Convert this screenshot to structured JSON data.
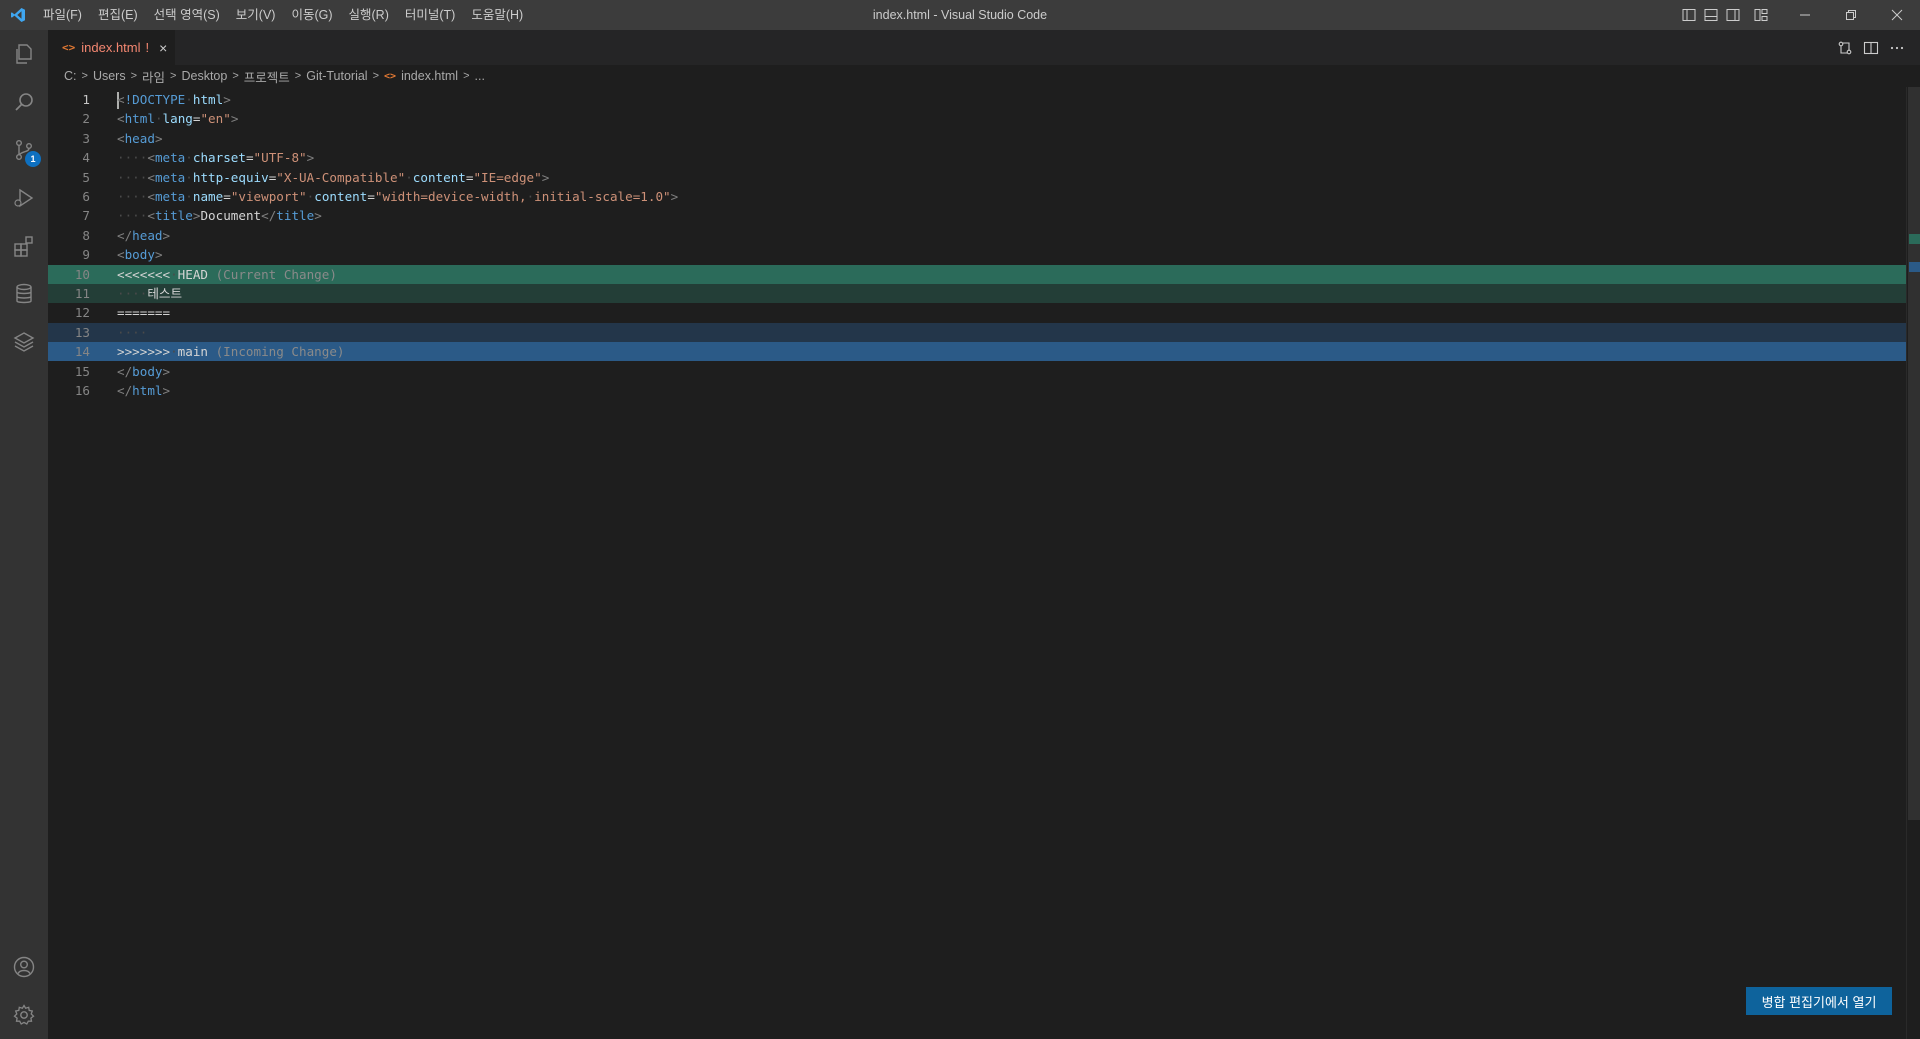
{
  "window": {
    "title": "index.html - Visual Studio Code"
  },
  "menu": [
    "파일(F)",
    "편집(E)",
    "선택 영역(S)",
    "보기(V)",
    "이동(G)",
    "실행(R)",
    "터미널(T)",
    "도움말(H)"
  ],
  "activity_bar": {
    "source_control_badge": "1"
  },
  "tab": {
    "label": "index.html",
    "modified_marker": "!",
    "close": "×"
  },
  "breadcrumbs": [
    "C:",
    "Users",
    "라임",
    "Desktop",
    "프로젝트",
    "Git-Tutorial",
    "index.html",
    "..."
  ],
  "code_lines": [
    {
      "n": "1",
      "segments": [
        [
          "t-bracket",
          "<"
        ],
        [
          "t-tag",
          "!DOCTYPE"
        ],
        [
          "ws",
          "·"
        ],
        [
          "t-attr",
          "html"
        ],
        [
          "t-bracket",
          ">"
        ]
      ]
    },
    {
      "n": "2",
      "segments": [
        [
          "t-bracket",
          "<"
        ],
        [
          "t-tag",
          "html"
        ],
        [
          "ws",
          "·"
        ],
        [
          "t-attr",
          "lang"
        ],
        [
          "t-text",
          "="
        ],
        [
          "t-str",
          "\"en\""
        ],
        [
          "t-bracket",
          ">"
        ]
      ]
    },
    {
      "n": "3",
      "segments": [
        [
          "t-bracket",
          "<"
        ],
        [
          "t-tag",
          "head"
        ],
        [
          "t-bracket",
          ">"
        ]
      ]
    },
    {
      "n": "4",
      "segments": [
        [
          "ws",
          "····"
        ],
        [
          "t-bracket",
          "<"
        ],
        [
          "t-tag",
          "meta"
        ],
        [
          "ws",
          "·"
        ],
        [
          "t-attr",
          "charset"
        ],
        [
          "t-text",
          "="
        ],
        [
          "t-str",
          "\"UTF-8\""
        ],
        [
          "t-bracket",
          ">"
        ]
      ]
    },
    {
      "n": "5",
      "segments": [
        [
          "ws",
          "····"
        ],
        [
          "t-bracket",
          "<"
        ],
        [
          "t-tag",
          "meta"
        ],
        [
          "ws",
          "·"
        ],
        [
          "t-attr",
          "http-equiv"
        ],
        [
          "t-text",
          "="
        ],
        [
          "t-str",
          "\"X-UA-Compatible\""
        ],
        [
          "ws",
          "·"
        ],
        [
          "t-attr",
          "content"
        ],
        [
          "t-text",
          "="
        ],
        [
          "t-str",
          "\"IE=edge\""
        ],
        [
          "t-bracket",
          ">"
        ]
      ]
    },
    {
      "n": "6",
      "segments": [
        [
          "ws",
          "····"
        ],
        [
          "t-bracket",
          "<"
        ],
        [
          "t-tag",
          "meta"
        ],
        [
          "ws",
          "·"
        ],
        [
          "t-attr",
          "name"
        ],
        [
          "t-text",
          "="
        ],
        [
          "t-str",
          "\"viewport\""
        ],
        [
          "ws",
          "·"
        ],
        [
          "t-attr",
          "content"
        ],
        [
          "t-text",
          "="
        ],
        [
          "t-str",
          "\"width=device-width,"
        ],
        [
          "ws",
          "·"
        ],
        [
          "t-str",
          "initial-scale=1.0\""
        ],
        [
          "t-bracket",
          ">"
        ]
      ]
    },
    {
      "n": "7",
      "segments": [
        [
          "ws",
          "····"
        ],
        [
          "t-bracket",
          "<"
        ],
        [
          "t-tag",
          "title"
        ],
        [
          "t-bracket",
          ">"
        ],
        [
          "t-text",
          "Document"
        ],
        [
          "t-bracket",
          "</"
        ],
        [
          "t-tag",
          "title"
        ],
        [
          "t-bracket",
          ">"
        ]
      ]
    },
    {
      "n": "8",
      "segments": [
        [
          "t-bracket",
          "</"
        ],
        [
          "t-tag",
          "head"
        ],
        [
          "t-bracket",
          ">"
        ]
      ]
    },
    {
      "n": "9",
      "segments": [
        [
          "t-bracket",
          "<"
        ],
        [
          "t-tag",
          "body"
        ],
        [
          "t-bracket",
          ">"
        ]
      ]
    },
    {
      "n": "10",
      "hl": "hl-current-header",
      "segments": [
        [
          "t-marker",
          "<<<<<<<"
        ],
        [
          "ws",
          "·"
        ],
        [
          "t-marker",
          "HEAD"
        ],
        [
          "t-hint",
          " (Current Change)"
        ]
      ]
    },
    {
      "n": "11",
      "hl": "hl-current-body",
      "segments": [
        [
          "ws",
          "····"
        ],
        [
          "t-text",
          "테스트"
        ]
      ]
    },
    {
      "n": "12",
      "segments": [
        [
          "t-marker",
          "======="
        ]
      ]
    },
    {
      "n": "13",
      "hl": "hl-incoming-body",
      "segments": [
        [
          "ws",
          "····"
        ]
      ]
    },
    {
      "n": "14",
      "hl": "hl-incoming-header",
      "segments": [
        [
          "t-marker",
          ">>>>>>>"
        ],
        [
          "ws",
          "·"
        ],
        [
          "t-marker",
          "main"
        ],
        [
          "t-hint",
          " (Incoming Change)"
        ]
      ]
    },
    {
      "n": "15",
      "segments": [
        [
          "t-bracket",
          "</"
        ],
        [
          "t-tag",
          "body"
        ],
        [
          "t-bracket",
          ">"
        ]
      ]
    },
    {
      "n": "16",
      "segments": [
        [
          "t-bracket",
          "</"
        ],
        [
          "t-tag",
          "html"
        ],
        [
          "t-bracket",
          ">"
        ]
      ]
    }
  ],
  "merge_button": {
    "label": "병합 편집기에서 열기"
  },
  "colors": {
    "current_change": "#2b6b5a",
    "incoming_change": "#2b5a87",
    "accent": "#0e639c"
  }
}
